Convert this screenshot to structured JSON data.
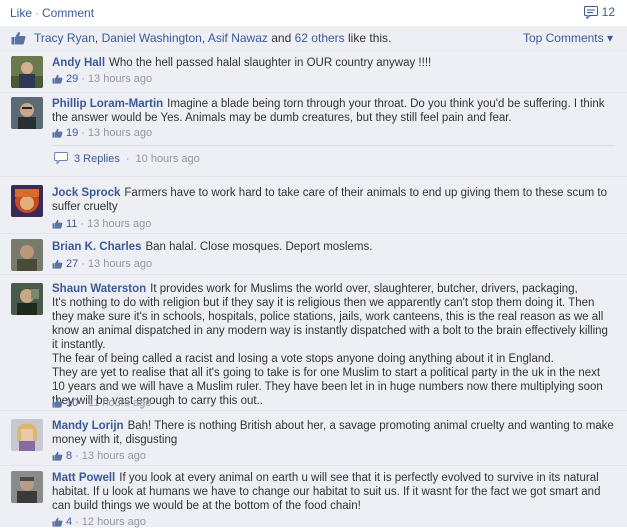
{
  "topbar": {
    "like_label": "Like",
    "separator": "·",
    "comment_label": "Comment",
    "comment_count": "12"
  },
  "likes": {
    "names": [
      "Tracy Ryan",
      "Daniel Washington",
      "Asif Nawaz"
    ],
    "and_text": "and",
    "others_link": "62 others",
    "suffix": "like this.",
    "top_comments": "Top Comments ▾"
  },
  "comments": [
    {
      "author": "Andy Hall",
      "text": "Who the hell passed halal slaughter in OUR country anyway !!!!",
      "likes": "29",
      "time": "13 hours ago"
    },
    {
      "author": "Phillip Loram-Martin",
      "text": "Imagine a blade being torn through your throat. Do you think you'd be suffering. I think the answer would be Yes. Animals may be dumb creatures, but they still feel pain and fear.",
      "likes": "19",
      "time": "13 hours ago",
      "replies_label": "3 Replies",
      "replies_time": "10 hours ago"
    },
    {
      "author": "Jock Sprock",
      "text": "Farmers have to work hard to take care of their animals to end up giving them to these scum to suffer cruelty",
      "likes": "11",
      "time": "13 hours ago"
    },
    {
      "author": "Brian K. Charles",
      "text": "Ban halal. Close mosques. Deport moslems.",
      "likes": "27",
      "time": "13 hours ago"
    },
    {
      "author": "Shaun Waterston",
      "text": "It provides work for Muslims the world over, slaughterer, butcher, drivers, packaging,\nIt's nothing to do with religion but if they say it is religious then we apparently can't stop them doing it. Then they make sure it's in schools, hospitals, police stations, jails, work canteens, this is the real reason as we all know an animal dispatched in any modern way is instantly dispatched with a bolt to the brain effectively killing it instantly.\nThe fear of being called a racist and losing a vote stops anyone doing anything about it in England.\nThey are yet to realise that all it's going to take is for one Muslim to start a political party in the uk in the next 10 years and we will have a Muslim ruler. They have been let in in huge numbers now there multiplying soon they will be vast enough to carry this out..",
      "likes": "10",
      "time": "11 hours ago"
    },
    {
      "author": "Mandy Lorijn",
      "text": "Bah! There is nothing British about her, a savage promoting animal cruelty and wanting to make money with it, disgusting",
      "likes": "8",
      "time": "13 hours ago"
    },
    {
      "author": "Matt Powell",
      "text": "If you look at every animal on earth u will see that it is perfectly evolved to survive in its natural habitat. If u look at humans we have to change our habitat to suit us. If it wasnt for the fact we got smart and can build things we would be at the bottom of the food chain!",
      "likes": "4",
      "time": "12 hours ago"
    }
  ],
  "colors": {
    "link": "#3b5998",
    "meta": "#9197a3",
    "panel_bg": "#edeff4"
  }
}
